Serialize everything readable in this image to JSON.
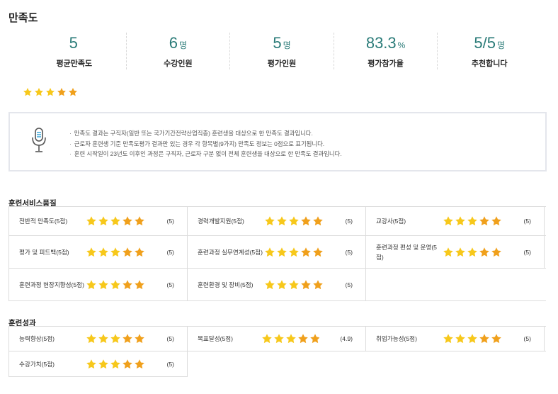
{
  "page_title": "만족도",
  "stats": [
    {
      "value": "5",
      "unit": "",
      "label": "평균만족도"
    },
    {
      "value": "6",
      "unit": "명",
      "label": "수강인원"
    },
    {
      "value": "5",
      "unit": "명",
      "label": "평가인원"
    },
    {
      "value": "83.3",
      "unit": "%",
      "label": "평가참가율"
    },
    {
      "value": "5/5",
      "unit": "명",
      "label": "추천합니다"
    }
  ],
  "average_rating": {
    "stars": 5,
    "max": 5
  },
  "notice": {
    "icon": "microphone-icon",
    "lines": [
      "만족도 결과는 구직자(일반 또는 국가기간전략산업직종) 훈련생을 대상으로 한 만족도 결과입니다.",
      "근로자 훈련생 기준 만족도평가 결과만 있는 경우 각 항목별(9가지) 만족도 정보는 0점으로 표기됩니다.",
      "훈련 시작일이 23년도 이후인 과정은 구직자, 근로자 구분 없이 전체 훈련생을 대상으로 한 만족도 결과입니다."
    ]
  },
  "sections": [
    {
      "title": "훈련서비스품질",
      "rows": [
        [
          {
            "name": "전반적 만족도(5점)",
            "stars": 5,
            "score": "(5)"
          },
          {
            "name": "경력개발지원(5점)",
            "stars": 5,
            "score": "(5)"
          },
          {
            "name": "교강사(5점)",
            "stars": 5,
            "score": "(5)"
          }
        ],
        [
          {
            "name": "평가 및 피드백(5점)",
            "stars": 5,
            "score": "(5)"
          },
          {
            "name": "훈련과정 실무연계성(5점)",
            "stars": 5,
            "score": "(5)"
          },
          {
            "name": "훈련과정 편성 및 운영(5점)",
            "stars": 5,
            "score": "(5)"
          }
        ],
        [
          {
            "name": "훈련과정 현장지향성(5점)",
            "stars": 5,
            "score": "(5)"
          },
          {
            "name": "훈련환경 및 장비(5점)",
            "stars": 5,
            "score": "(5)"
          }
        ]
      ]
    },
    {
      "title": "훈련성과",
      "rows": [
        [
          {
            "name": "능력향상(5점)",
            "stars": 5,
            "score": "(5)"
          },
          {
            "name": "목표달성(5점)",
            "stars": 4.9,
            "score": "(4.9)"
          },
          {
            "name": "취업가능성(5점)",
            "stars": 5,
            "score": "(5)"
          }
        ],
        [
          {
            "name": "수강가치(5점)",
            "stars": 5,
            "score": "(5)"
          }
        ]
      ]
    }
  ],
  "colors": {
    "accent": "#2a7b78",
    "star_light": "#f7c81b",
    "star_dark": "#f0a01c",
    "border": "#dcdcdc"
  }
}
